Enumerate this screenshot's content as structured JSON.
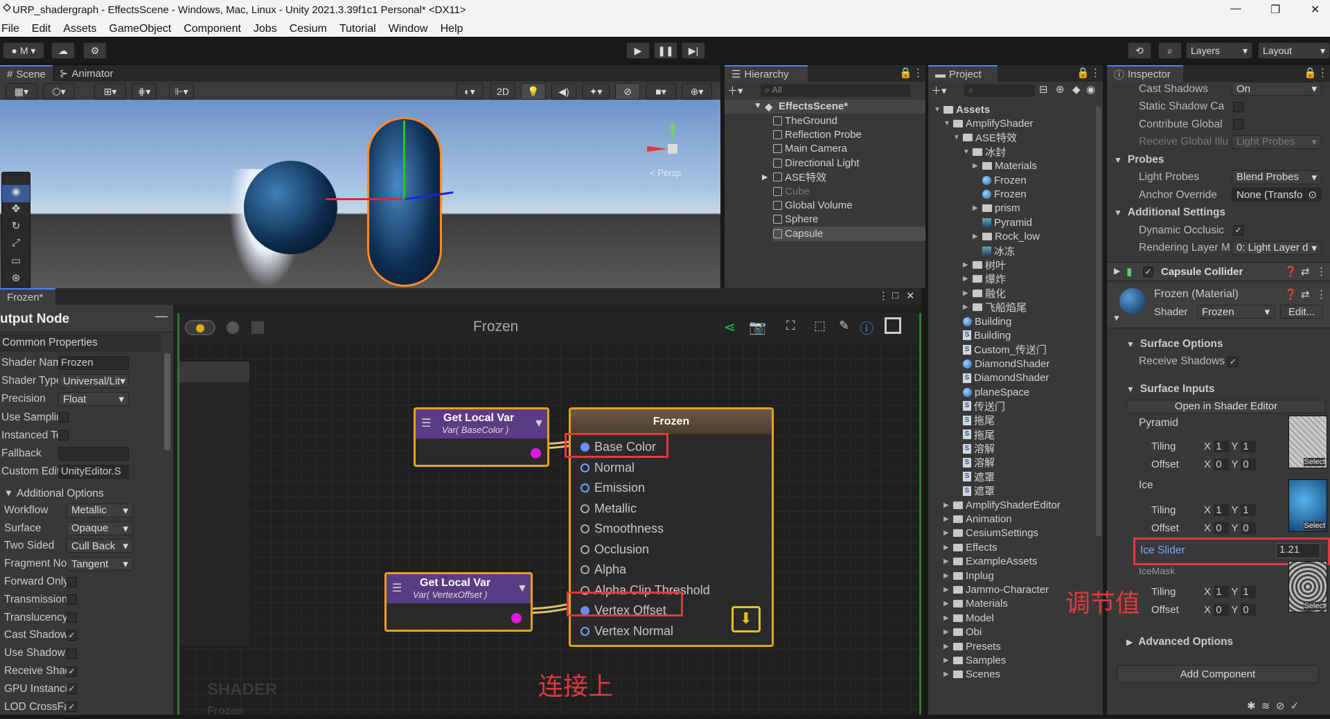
{
  "window": {
    "title": "URP_shadergraph - EffectsScene - Windows, Mac, Linux - Unity 2021.3.39f1c1 Personal* <DX11>"
  },
  "menu": [
    "File",
    "Edit",
    "Assets",
    "GameObject",
    "Component",
    "Jobs",
    "Cesium",
    "Tutorial",
    "Window",
    "Help"
  ],
  "toolbar": {
    "account": "M",
    "layers": "Layers",
    "layout": "Layout"
  },
  "scene_tabs": {
    "scene": "Scene",
    "animator": "Animator",
    "mode2d": "2D",
    "persp": "< Persp"
  },
  "hierarchy": {
    "tab": "Hierarchy",
    "search_placeholder": "All",
    "scene": "EffectsScene*",
    "items": [
      "TheGround",
      "Reflection Probe",
      "Main Camera",
      "Directional Light",
      "ASE特效",
      "Cube",
      "Global Volume",
      "Sphere",
      "Capsule"
    ]
  },
  "project": {
    "tab": "Project",
    "items": [
      "Assets",
      "AmplifyShader",
      "ASE特效",
      "冰封",
      "Materials",
      "Frozen",
      "Frozen",
      "prism",
      "Pyramid",
      "Rock_low",
      "冰冻",
      "树叶",
      "爆炸",
      "融化",
      "飞船焰尾",
      "Building",
      "Building",
      "Custom_传送门",
      "DiamondShader",
      "DiamondShader",
      "planeSpace",
      "传送门",
      "拖尾",
      "拖尾",
      "溶解",
      "溶解",
      "遮罩",
      "遮罩",
      "AmplifyShaderEditor",
      "Animation",
      "CesiumSettings",
      "Effects",
      "ExampleAssets",
      "Inplug",
      "Jammo-Character",
      "Materials",
      "Model",
      "Obi",
      "Presets",
      "Samples",
      "Scenes"
    ]
  },
  "inspector": {
    "tab": "Inspector",
    "cast_shadows": {
      "label": "Cast Shadows",
      "value": "On"
    },
    "static_shadow": "Static Shadow Ca",
    "contribute_global": "Contribute Global",
    "receive_global": {
      "label": "Receive Global Illu",
      "value": "Light Probes"
    },
    "probes": "Probes",
    "light_probes": {
      "label": "Light Probes",
      "value": "Blend Probes"
    },
    "anchor_override": {
      "label": "Anchor Override",
      "value": "None (Transfo"
    },
    "additional_settings": "Additional Settings",
    "dynamic_occlusion": "Dynamic Occlusic",
    "rendering_layer": {
      "label": "Rendering Layer M",
      "value": "0: Light Layer d"
    },
    "capsule_collider": "Capsule Collider",
    "material_name": "Frozen (Material)",
    "shader": {
      "label": "Shader",
      "value": "Frozen",
      "edit": "Edit..."
    },
    "surface_options": "Surface Options",
    "receive_shadows": "Receive Shadows",
    "surface_inputs": "Surface Inputs",
    "open_editor": "Open in Shader Editor",
    "tex1": {
      "name": "Pyramid",
      "tiling": "Tiling",
      "offset": "Offset"
    },
    "tex2": {
      "name": "Ice",
      "tiling": "Tiling",
      "offset": "Offset"
    },
    "ice_slider": {
      "label": "Ice Slider",
      "value": "1.21"
    },
    "tex3": {
      "name": "IceMask",
      "tiling": "Tiling",
      "offset": "Offset"
    },
    "select": "Select",
    "x": "X",
    "y": "Y",
    "v1": "1",
    "v0": "0",
    "advanced": "Advanced Options",
    "add_component": "Add Component",
    "annotation": "调节值"
  },
  "shader_editor": {
    "tab": "Frozen*",
    "title": "Frozen",
    "output_node": "utput Node",
    "common_props": "Common Properties",
    "rows": [
      {
        "label": "Shader Name",
        "value": "Frozen",
        "type": "text"
      },
      {
        "label": "Shader Type",
        "value": "Universal/Lit",
        "type": "drop"
      },
      {
        "label": "Precision",
        "value": "Float",
        "type": "drop"
      },
      {
        "label": "Use Sampling",
        "value": "",
        "type": "chk"
      },
      {
        "label": "Instanced Te",
        "value": "",
        "type": "chk"
      },
      {
        "label": "Fallback",
        "value": "",
        "type": "text"
      },
      {
        "label": "Custom Edito",
        "value": "UnityEditor.S",
        "type": "text"
      }
    ],
    "additional_options": "Additional Options",
    "opts": [
      {
        "label": "Workflow",
        "value": "Metallic",
        "type": "drop"
      },
      {
        "label": "Surface",
        "value": "Opaque",
        "type": "drop"
      },
      {
        "label": "Two Sided",
        "value": "Cull Back",
        "type": "drop"
      },
      {
        "label": "Fragment Norr",
        "value": "Tangent",
        "type": "drop"
      },
      {
        "label": "Forward Only",
        "value": "",
        "type": "chk"
      },
      {
        "label": "Transmission",
        "value": "",
        "type": "chk"
      },
      {
        "label": "Translucency",
        "value": "",
        "type": "chk"
      },
      {
        "label": "Cast Shadows",
        "value": "✓",
        "type": "chk"
      },
      {
        "label": "Use Shadow",
        "value": "",
        "type": "chk"
      },
      {
        "label": "Receive Shad",
        "value": "✓",
        "type": "chk"
      },
      {
        "label": "GPU Instancin",
        "value": "✓",
        "type": "chk"
      },
      {
        "label": "LOD CrossFad",
        "value": "✓",
        "type": "chk"
      }
    ],
    "node1": {
      "title": "Get Local Var",
      "sub": "Var( BaseColor )"
    },
    "node2": {
      "title": "Get Local Var",
      "sub": "Var( VertexOffset )"
    },
    "frozen_node": {
      "title": "Frozen",
      "ports": [
        "Base Color",
        "Normal",
        "Emission",
        "Metallic",
        "Smoothness",
        "Occlusion",
        "Alpha",
        "Alpha Clip Threshold",
        "Vertex Offset",
        "Vertex Normal"
      ]
    },
    "watermark": "SHADER",
    "watermark_sub": "Frozen",
    "annotation": "连接上"
  },
  "colors": {
    "accent": "#4c7fff",
    "annotation": "#e0393f",
    "node_border": "#e6a21e",
    "node_header": "#5a3c84"
  }
}
